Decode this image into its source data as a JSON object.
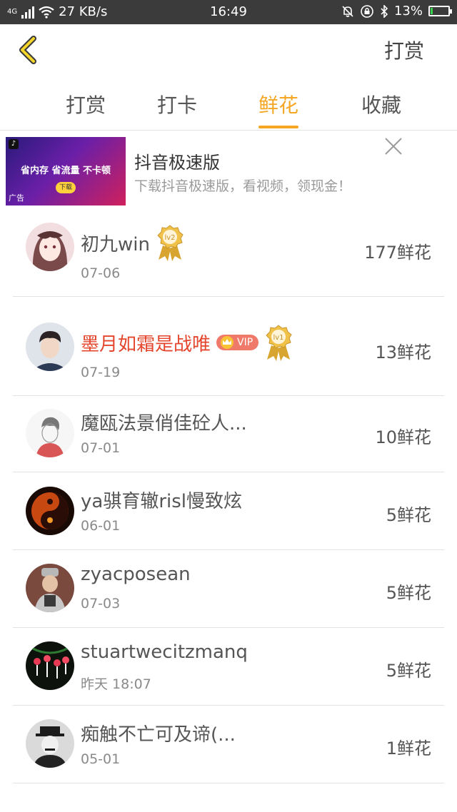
{
  "status_bar": {
    "network": "4G",
    "speed": "27 KB/s",
    "time": "16:49",
    "battery": "13%",
    "battery_level": 0.13
  },
  "header": {
    "action_label": "打赏"
  },
  "tabs": [
    {
      "label": "打赏",
      "active": false
    },
    {
      "label": "打卡",
      "active": false
    },
    {
      "label": "鲜花",
      "active": true
    },
    {
      "label": "收藏",
      "active": false
    }
  ],
  "ad": {
    "title": "抖音极速版",
    "description": "下载抖音极速版，看视频，领现金！",
    "image_slogan": "省内存 省流量 不卡顿",
    "image_button": "下载",
    "image_tag": "广告"
  },
  "list": [
    {
      "name": "初九win",
      "date": "07-06",
      "count": "177鲜花",
      "medal": "lv2",
      "vip": false,
      "highlight": false,
      "avatar": "anime-girl"
    },
    {
      "name": "墨月如霜是战唯",
      "date": "07-19",
      "count": "13鲜花",
      "medal": "lv1",
      "vip": true,
      "vip_label": "VIP",
      "highlight": true,
      "avatar": "young-man"
    },
    {
      "name": "魔瓯法景俏佳砼人...",
      "date": "07-01",
      "count": "10鲜花",
      "vip": false,
      "highlight": false,
      "avatar": "sketch-boy"
    },
    {
      "name": "ya骐育辙risl慢致炫",
      "date": "06-01",
      "count": "5鲜花",
      "vip": false,
      "highlight": false,
      "avatar": "fire-yinyang"
    },
    {
      "name": "zyacposean",
      "date": "07-03",
      "count": "5鲜花",
      "vip": false,
      "highlight": false,
      "avatar": "man-cap"
    },
    {
      "name": "stuartwecitzmanq",
      "date": "昨天 18:07",
      "count": "5鲜花",
      "vip": false,
      "highlight": false,
      "avatar": "flowers"
    },
    {
      "name": "痴触不亡可及谛(...",
      "date": "05-01",
      "count": "1鲜花",
      "vip": false,
      "highlight": false,
      "avatar": "bw-man-hat"
    }
  ],
  "colors": {
    "accent": "#f5a623",
    "highlight_name": "#e4462d",
    "vip_badge": "#f07a6a",
    "status_bar": "#3b3b3b"
  }
}
